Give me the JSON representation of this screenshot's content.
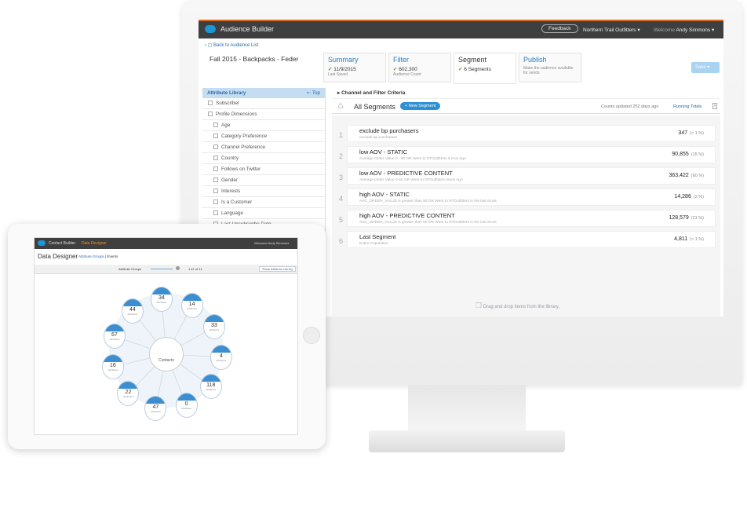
{
  "app": {
    "title": "Audience Builder",
    "feedback": "Feedback",
    "org": "Northern Trail Outfitters",
    "welcome": "Welcome",
    "user": "Andy Simmons",
    "back": "Back to Audience List",
    "audience_name": "Fall 2015 - Backpacks - Feder",
    "save": "Save"
  },
  "tabs": [
    {
      "label": "Summary",
      "value": "11/9/2015",
      "sub": "Last Saved"
    },
    {
      "label": "Filter",
      "value": "602,300",
      "sub": "Audience Count"
    },
    {
      "label": "Segment",
      "value": "6 Segments",
      "sub": ""
    },
    {
      "label": "Publish",
      "value": "",
      "sub": "Make the audience available for sends"
    }
  ],
  "library": {
    "title": "Attribute Library",
    "top": "Top",
    "groups": [
      "Subscriber",
      "Profile Dimensions"
    ],
    "items": [
      "Age",
      "Category Preference",
      "Channel Preference",
      "Country",
      "Follows on Twitter",
      "Gender",
      "Interests",
      "Is a Customer",
      "Language",
      "Last Unsubscribe Date"
    ]
  },
  "criteria": "Channel and Filter Criteria",
  "segments_header": {
    "title": "All Segments",
    "new": "+ New Segment",
    "counts": "Counts updated 252 days ago",
    "running": "Running Totals"
  },
  "segments": [
    {
      "n": "1",
      "name": "exclude bp purchasers",
      "desc": "exclude bp purchasers",
      "count": "347",
      "pct": "(< 1 %)"
    },
    {
      "n": "2",
      "name": "low AOV - STATIC",
      "desc": "Average Order Value 0 - 50 OR  Went to NTOutfitters 6 mos Ago",
      "count": "90,855",
      "pct": "(15 %)"
    },
    {
      "n": "3",
      "name": "low AOV - PREDICTIVE CONTENT",
      "desc": "Average Order Value 0-50 OR  Went to NTOutfitters 6mos Ago",
      "count": "363,422",
      "pct": "(60 %)"
    },
    {
      "n": "4",
      "name": "high AOV - STATIC",
      "desc": "AVG_ORDER_VALUE is greater than  50 OR  Went to NTOutfitters in the last 6mos",
      "count": "14,286",
      "pct": "(2 %)"
    },
    {
      "n": "5",
      "name": "high AOV - PREDICTIVE CONTENT",
      "desc": "AVG_ORDER_VALUE is greater than  50 OR  Went to NTOutfitters in the last 6mos",
      "count": "128,579",
      "pct": "(21 %)"
    },
    {
      "n": "6",
      "name": "Last Segment",
      "desc": "Entire Population",
      "count": "4,811",
      "pct": "(< 1 %)"
    }
  ],
  "drop_hint": "Drag and drop items from the library.",
  "tablet": {
    "app": "Contact Builder",
    "section": "Data Designer",
    "welcome": "Welcome",
    "user": "Andy Simmons",
    "title": "Data Designer",
    "link1": "Attribute Groups",
    "link2": "Events",
    "groups_label": "Attribute Groups",
    "paging": "1-11 of 11",
    "show_lib": "Show Attribute Library",
    "center": "Contacts",
    "attr_label": "Attributes",
    "nodes": [
      "34",
      "14",
      "33",
      "4",
      "118",
      "0",
      "47",
      "22",
      "16",
      "67",
      "44"
    ]
  },
  "colors": {
    "accent": "#1b96d6",
    "header": "#3f3f3f",
    "orange": "#d86a1e",
    "check": "#4caf2a"
  }
}
